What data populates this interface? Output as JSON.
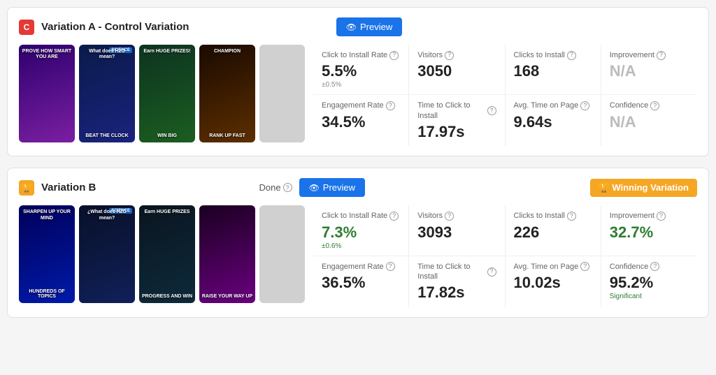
{
  "variations": [
    {
      "id": "a",
      "badge_letter": "C",
      "badge_color": "badge-red",
      "title": "Variation A - Control Variation",
      "status": null,
      "preview_label": "Preview",
      "winning": false,
      "winning_label": null,
      "screenshots": [
        {
          "bg": "thumb-purple",
          "top": "PROVE\nHOW SMART\nYOU ARE",
          "bottom": null
        },
        {
          "bg": "thumb-dark-blue",
          "science": "SCIENCE",
          "top": "What does\nH2O mean?",
          "bottom": "BEAT THE CLOCK"
        },
        {
          "bg": "thumb-dark-green",
          "top": "Earn\nHUGE PRIZES!",
          "bottom": "WIN BIG"
        },
        {
          "bg": "thumb-dark-rank",
          "top": "CHAMPION",
          "bottom": "RANK UP FAST"
        },
        {
          "bg": "grey-thumb",
          "top": null,
          "bottom": null
        }
      ],
      "stats_row1": [
        {
          "label": "Click to Install Rate",
          "value": "5.5%",
          "value_color": "",
          "sub": "±0.5%"
        },
        {
          "label": "Visitors",
          "value": "3050",
          "value_color": "",
          "sub": null
        },
        {
          "label": "Clicks to Install",
          "value": "168",
          "value_color": "",
          "sub": null
        },
        {
          "label": "Improvement",
          "value": "N/A",
          "value_color": "gray",
          "sub": null
        }
      ],
      "stats_row2": [
        {
          "label": "Engagement Rate",
          "value": "34.5%",
          "value_color": "",
          "sub": null
        },
        {
          "label": "Time to Click to Install",
          "value": "17.97s",
          "value_color": "",
          "sub": null
        },
        {
          "label": "Avg. Time on Page",
          "value": "9.64s",
          "value_color": "",
          "sub": null
        },
        {
          "label": "Confidence",
          "value": "N/A",
          "value_color": "gray",
          "sub": null
        }
      ]
    },
    {
      "id": "b",
      "badge_letter": "",
      "badge_color": "badge-yellow",
      "title": "Variation B",
      "status": "Done",
      "preview_label": "Preview",
      "winning": true,
      "winning_label": "Winning Variation",
      "screenshots": [
        {
          "bg": "thumb-blue-b1",
          "top": "SHARPEN UP\nYOUR MIND",
          "bottom": "HUNDREDS\nOF TOPICS"
        },
        {
          "bg": "thumb-blue-b2",
          "science": "SCIENCE",
          "top": "¿What does\nH2O mean?",
          "bottom": null
        },
        {
          "bg": "thumb-dark-b3",
          "top": "Earn\nHUGE PRIZES",
          "bottom": "PROGRESS AND WIN"
        },
        {
          "bg": "thumb-purple-b4",
          "top": null,
          "bottom": "RAISE YOUR WAY UP"
        },
        {
          "bg": "grey-thumb",
          "top": null,
          "bottom": null
        }
      ],
      "stats_row1": [
        {
          "label": "Click to Install Rate",
          "value": "7.3%",
          "value_color": "green",
          "sub": "±0.6%",
          "sub_color": "green"
        },
        {
          "label": "Visitors",
          "value": "3093",
          "value_color": "",
          "sub": null
        },
        {
          "label": "Clicks to Install",
          "value": "226",
          "value_color": "",
          "sub": null
        },
        {
          "label": "Improvement",
          "value": "32.7%",
          "value_color": "green",
          "sub": null
        }
      ],
      "stats_row2": [
        {
          "label": "Engagement Rate",
          "value": "36.5%",
          "value_color": "",
          "sub": null
        },
        {
          "label": "Time to Click to Install",
          "value": "17.82s",
          "value_color": "",
          "sub": null
        },
        {
          "label": "Avg. Time on Page",
          "value": "10.02s",
          "value_color": "",
          "sub": null
        },
        {
          "label": "Confidence",
          "value": "95.2%",
          "value_color": "",
          "sub": "Significant",
          "sub_color": "green"
        }
      ]
    }
  ]
}
